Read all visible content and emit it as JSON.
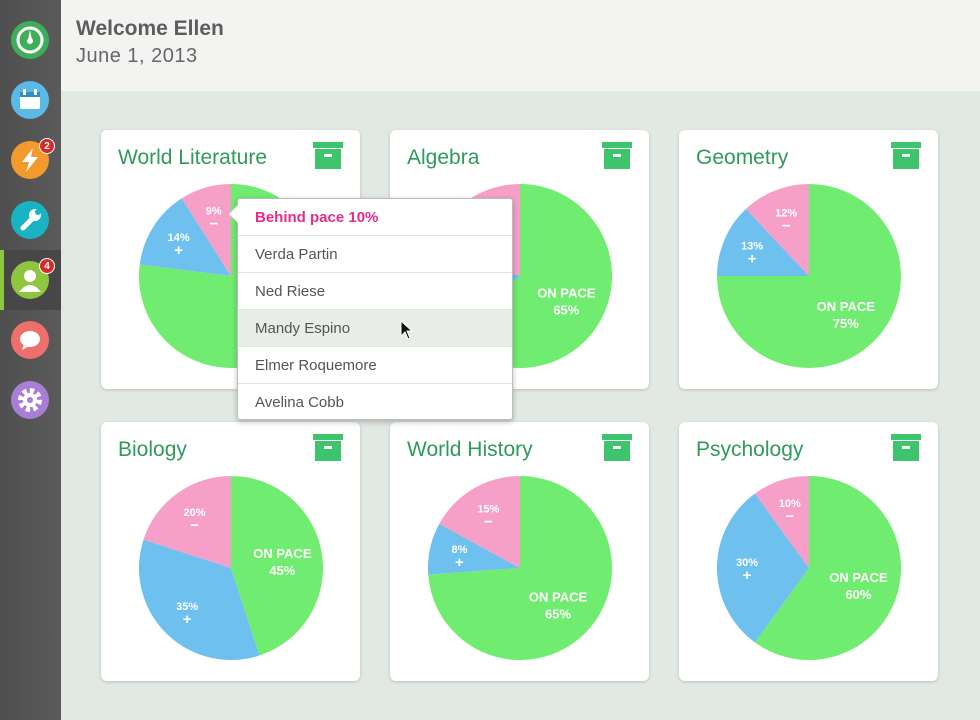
{
  "header": {
    "welcome": "Welcome Ellen",
    "date": "June 1, 2013"
  },
  "sidebar": {
    "items": [
      {
        "icon": "dashboard-icon",
        "color": "#3fae5a",
        "badge": ""
      },
      {
        "icon": "calendar-icon",
        "color": "#5bb9e8",
        "badge": ""
      },
      {
        "icon": "lightning-icon",
        "color": "#f49a2c",
        "badge": "2"
      },
      {
        "icon": "wrench-icon",
        "color": "#1ab3c4",
        "badge": ""
      },
      {
        "icon": "student-icon",
        "color": "#8fc63f",
        "badge": "4"
      },
      {
        "icon": "chat-icon",
        "color": "#ef6f6c",
        "badge": ""
      },
      {
        "icon": "gear-icon",
        "color": "#a77fd6",
        "badge": ""
      }
    ]
  },
  "colors": {
    "on_pace": "#70ec70",
    "ahead": "#6ec0ee",
    "behind": "#f6a0c9",
    "title": "#2f9a5c",
    "archive": "#3dc46d"
  },
  "courses": [
    {
      "title": "World Literature",
      "on_pace": 77,
      "ahead": 14,
      "behind": 9,
      "labels": {
        "ahead": "14%",
        "behind": "9%",
        "on_pace": ""
      }
    },
    {
      "title": "Algebra",
      "on_pace": 65,
      "ahead": 15,
      "behind": 20,
      "labels": {
        "ahead": "",
        "behind": "",
        "on_pace": "ON PACE",
        "on_pace_pct": "65%"
      }
    },
    {
      "title": "Geometry",
      "on_pace": 75,
      "ahead": 13,
      "behind": 12,
      "labels": {
        "ahead": "13%",
        "behind": "12%",
        "on_pace": "ON PACE",
        "on_pace_pct": "75%"
      }
    },
    {
      "title": "Biology",
      "on_pace": 45,
      "ahead": 35,
      "behind": 20,
      "labels": {
        "ahead": "35%",
        "behind": "20%",
        "on_pace": "ON PACE",
        "on_pace_pct": "45%"
      }
    },
    {
      "title": "World History",
      "on_pace": 65,
      "ahead": 8,
      "behind": 15,
      "labels": {
        "ahead": "8%",
        "behind": "15%",
        "on_pace": "ON PACE",
        "on_pace_pct": "65%"
      }
    },
    {
      "title": "Psychology",
      "on_pace": 60,
      "ahead": 30,
      "behind": 10,
      "labels": {
        "ahead": "30%",
        "behind": "10%",
        "on_pace": "ON PACE",
        "on_pace_pct": "60%"
      }
    }
  ],
  "popup": {
    "heading": "Behind pace 10%",
    "students": [
      "Verda Partin",
      "Ned Riese",
      "Mandy Espino",
      "Elmer Roquemore",
      "Avelina Cobb"
    ]
  }
}
